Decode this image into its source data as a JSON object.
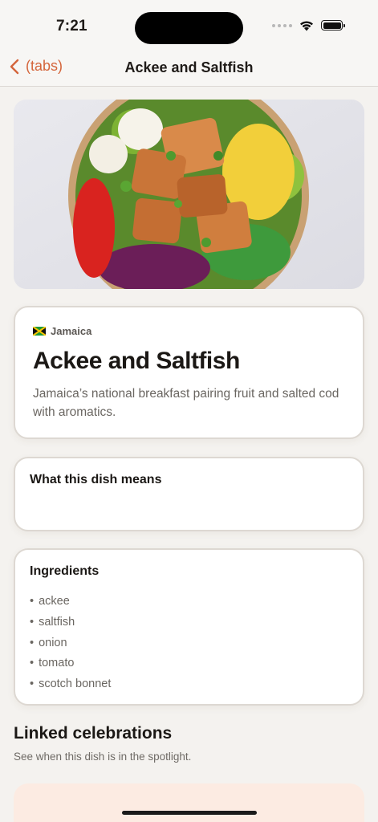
{
  "status_bar": {
    "time": "7:21",
    "icons": [
      "signal-icon",
      "wifi-icon",
      "battery-icon"
    ]
  },
  "nav": {
    "back_label": "(tabs)",
    "title": "Ackee and Saltfish",
    "accent": "#d4653b"
  },
  "hero": {
    "image": "salad-bowl-photo"
  },
  "dish": {
    "country": "Jamaica",
    "flag": "jamaica-flag-icon",
    "title": "Ackee and Saltfish",
    "description": "Jamaica’s national breakfast pairing fruit and salted cod with aromatics."
  },
  "meaning": {
    "heading": "What this dish means"
  },
  "ingredients": {
    "heading": "Ingredients",
    "items": [
      "ackee",
      "saltfish",
      "onion",
      "tomato",
      "scotch bonnet"
    ]
  },
  "linked": {
    "title": "Linked celebrations",
    "subtitle": "See when this dish is in the spotlight."
  }
}
